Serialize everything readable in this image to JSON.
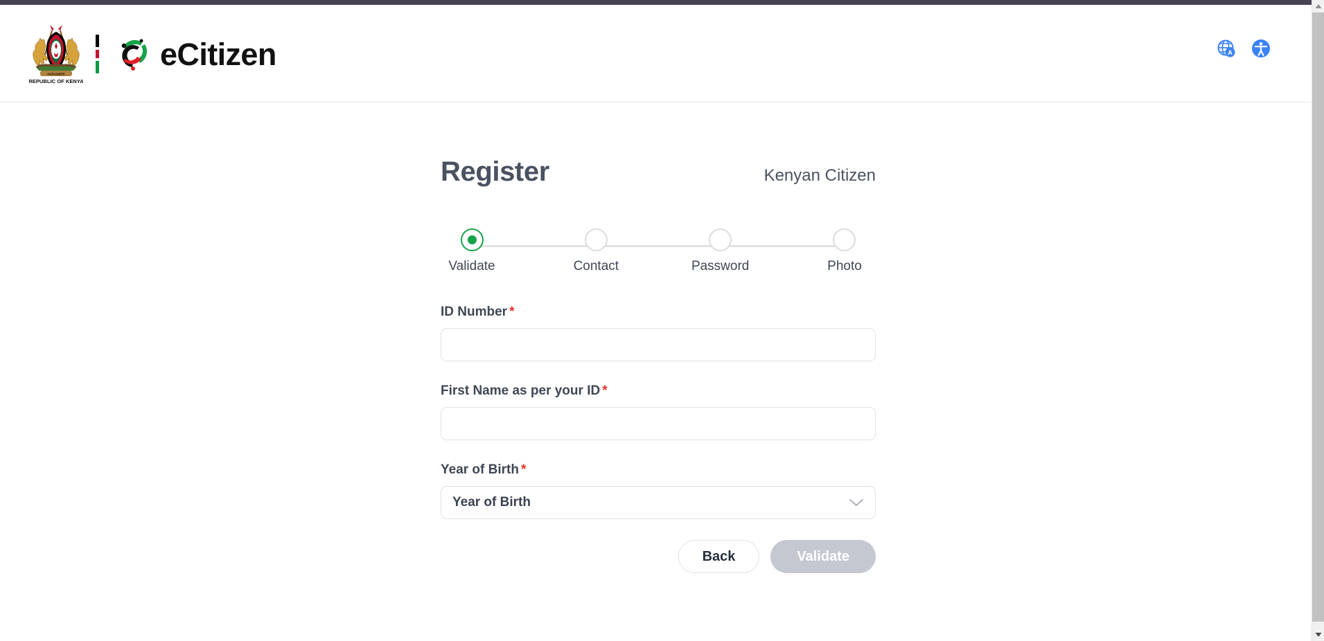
{
  "header": {
    "emblem_caption": "REPUBLIC OF KENYA",
    "wordmark": "eCitizen",
    "actions": [
      {
        "name": "translate-icon",
        "label": "Translate"
      },
      {
        "name": "accessibility-icon",
        "label": "Accessibility"
      }
    ]
  },
  "main": {
    "title": "Register",
    "citizen_type": "Kenyan Citizen",
    "stepper": {
      "active_index": 0,
      "steps": [
        {
          "label": "Validate"
        },
        {
          "label": "Contact"
        },
        {
          "label": "Password"
        },
        {
          "label": "Photo"
        }
      ]
    },
    "fields": [
      {
        "label": "ID Number",
        "required_mark": "*",
        "value": "",
        "placeholder": ""
      },
      {
        "label": "First Name as per your ID",
        "required_mark": "*",
        "value": "",
        "placeholder": ""
      },
      {
        "label": "Year of Birth",
        "required_mark": "*",
        "selected": "Year of Birth"
      }
    ],
    "buttons": {
      "back": "Back",
      "validate": "Validate"
    }
  },
  "colors": {
    "top_strip": "#474154",
    "title": "#4a5260",
    "accent_green": "#16a34a",
    "required_red": "#e0342b",
    "disabled_button": "#c5c8d0",
    "border": "#e2e2e4"
  }
}
